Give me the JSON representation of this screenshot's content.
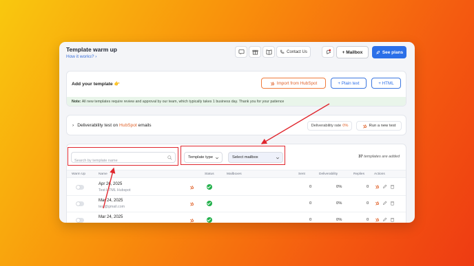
{
  "header": {
    "title": "Template warm up",
    "subtitle": "How it works?",
    "contact_label": "Contact Us",
    "mailbox_label": "+ Mailbox",
    "plans_label": "See plans"
  },
  "add_template": {
    "label": "Add your template",
    "hubspot_label": "Import from HubSpot",
    "plain_label": "+ Plain text",
    "html_label": "+ HTML",
    "note_bold": "Note:",
    "note_text": " All new templates require review and approval by our team, which typically takes 1 business day. Thank you for your patience"
  },
  "deliverability": {
    "text_prefix": "Deliverability test on ",
    "text_brand": "HubSpot",
    "text_suffix": " emails",
    "rate_label": "Deliverability rate",
    "rate_value": "0%",
    "run_label": "Run a new test"
  },
  "filters": {
    "search_placeholder": "Search by template name",
    "template_type": "Template type",
    "select_mailbox": "Select mailbox",
    "count": "37",
    "count_suffix": " templates are added"
  },
  "table": {
    "columns": [
      "Warm Up",
      "Name",
      "Status",
      "Mailboxes",
      "Sent",
      "Deliverability",
      "Replies",
      "Actions"
    ],
    "rows": [
      {
        "date": "Apr 26, 2025",
        "sub": "Test HTML Hubspot",
        "sent": "0",
        "deliverability": "0%",
        "replies": "0"
      },
      {
        "date": "Mar 24, 2025",
        "sub": "test@gmail.com",
        "sent": "0",
        "deliverability": "0%",
        "replies": "0"
      },
      {
        "date": "Mar 24, 2025",
        "sub": "",
        "sent": "0",
        "deliverability": "0%",
        "replies": "0"
      }
    ]
  },
  "colors": {
    "accent_blue": "#2b6fe8",
    "hubspot_orange": "#e0622a",
    "status_green": "#22b04b",
    "annotation_red": "#e0262d"
  },
  "icons": [
    "question-icon",
    "gift-icon",
    "book-icon",
    "phone-icon",
    "notification-icon",
    "plus-icon",
    "rocket-icon",
    "hubspot-icon",
    "chevron-right-icon",
    "search-icon",
    "chevron-down-icon",
    "check-icon",
    "edit-icon",
    "trash-icon",
    "sort-icon"
  ]
}
